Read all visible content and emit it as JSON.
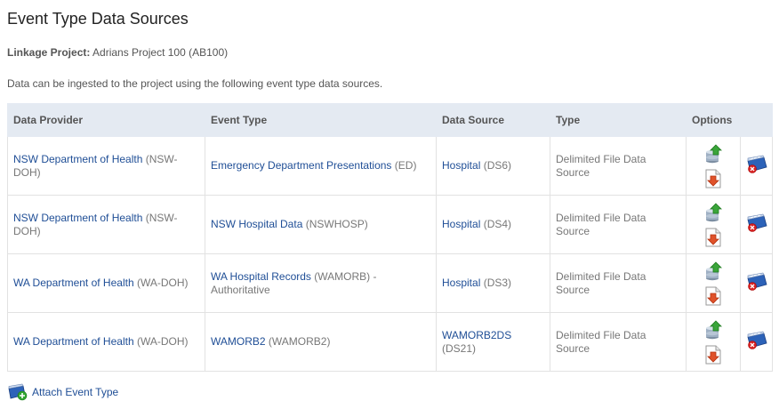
{
  "page": {
    "title": "Event Type Data Sources",
    "project_label": "Linkage Project:",
    "project_value": "Adrians Project 100 (AB100)",
    "intro": "Data can be ingested to the project using the following event type data sources."
  },
  "table": {
    "headers": [
      "Data Provider",
      "Event Type",
      "Data Source",
      "Type",
      "Options"
    ],
    "rows": [
      {
        "provider_name": "NSW Department of Health",
        "provider_code": "(NSW-DOH)",
        "event_name": "Emergency Department Presentations",
        "event_code": "(ED)",
        "event_suffix": "",
        "source_name": "Hospital",
        "source_code": "(DS6)",
        "type": "Delimited File Data Source"
      },
      {
        "provider_name": "NSW Department of Health",
        "provider_code": "(NSW-DOH)",
        "event_name": "NSW Hospital Data",
        "event_code": "(NSWHOSP)",
        "event_suffix": "",
        "source_name": "Hospital",
        "source_code": "(DS4)",
        "type": "Delimited File Data Source"
      },
      {
        "provider_name": "WA Department of Health",
        "provider_code": "(WA-DOH)",
        "event_name": "WA Hospital Records",
        "event_code": "(WAMORB)",
        "event_suffix": "- Authoritative",
        "source_name": "Hospital",
        "source_code": "(DS3)",
        "type": "Delimited File Data Source"
      },
      {
        "provider_name": "WA Department of Health",
        "provider_code": "(WA-DOH)",
        "event_name": "WAMORB2",
        "event_code": "(WAMORB2)",
        "event_suffix": "",
        "source_name": "WAMORB2DS",
        "source_code": "(DS21)",
        "type": "Delimited File Data Source"
      }
    ]
  },
  "actions": {
    "attach_label": "Attach Event Type"
  },
  "icons": {
    "upload": "database-upload-icon",
    "download": "document-download-icon",
    "remove": "database-remove-icon",
    "attach": "database-add-icon"
  },
  "colors": {
    "link": "#1f4e96",
    "header_bg": "#e4eaf2",
    "text": "#555555"
  }
}
